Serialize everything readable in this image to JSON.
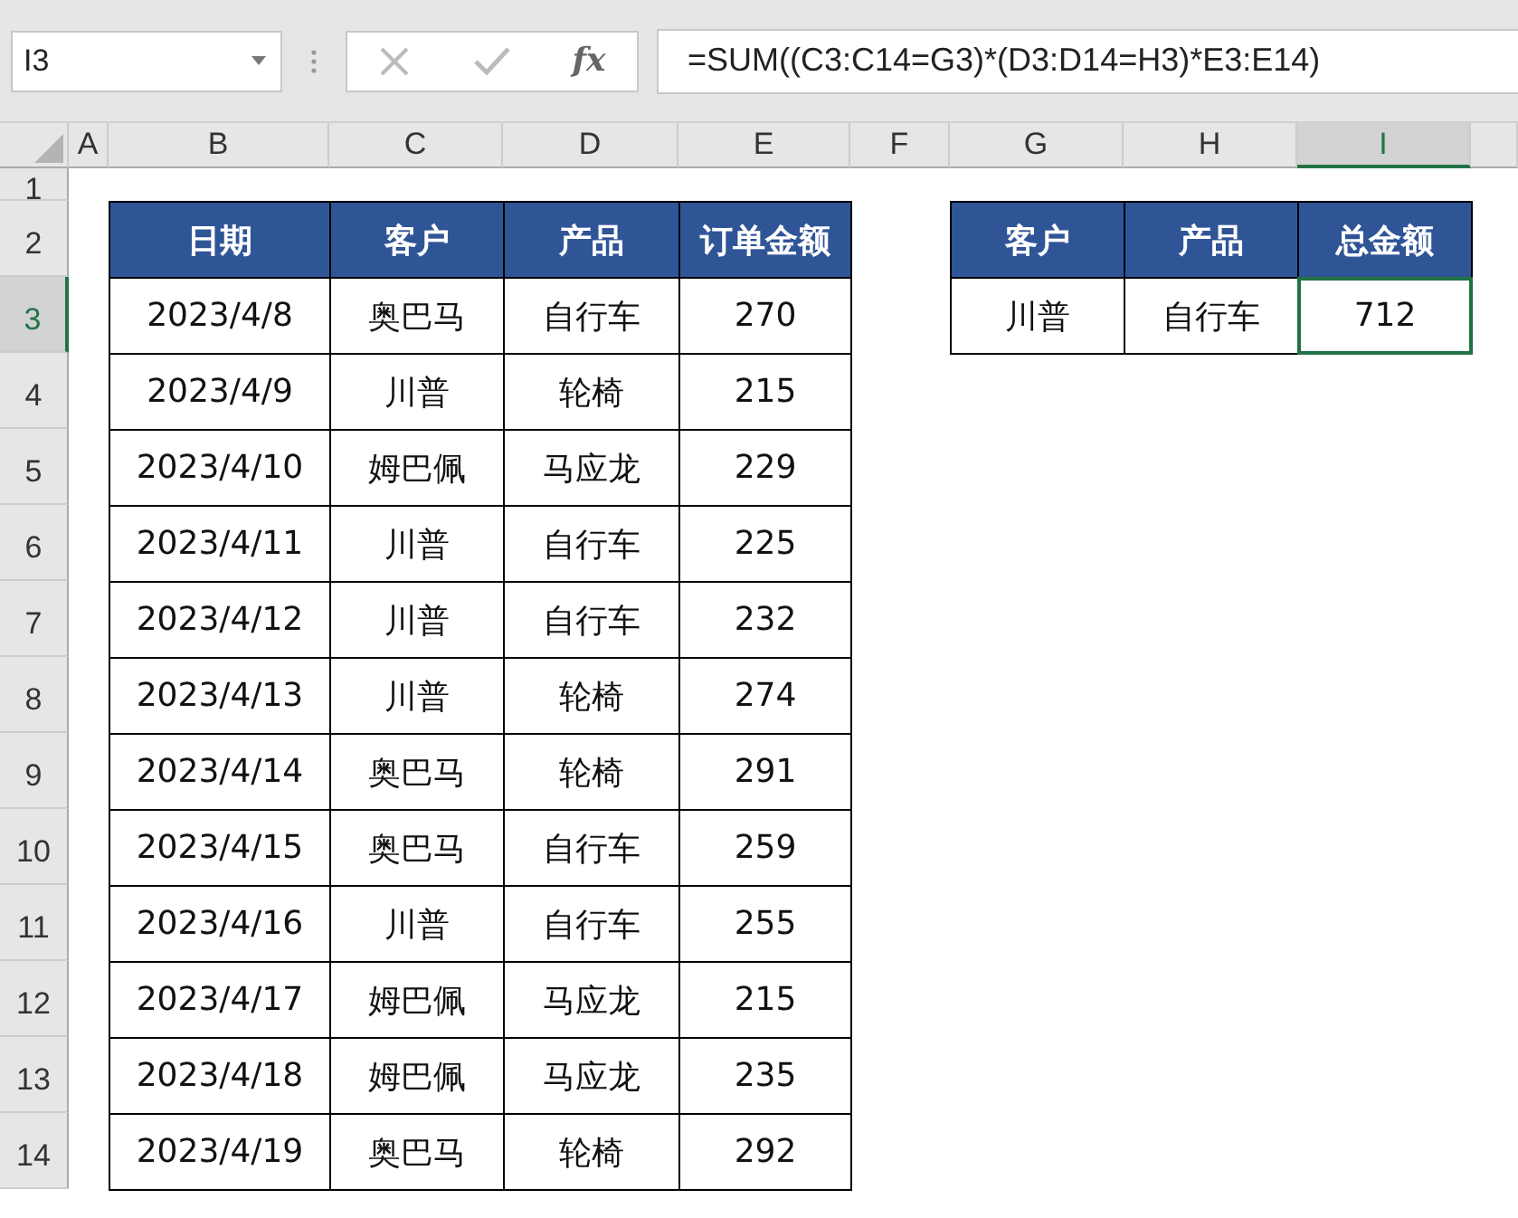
{
  "formula_bar": {
    "name_box": "I3",
    "function_label": "fx",
    "formula": "=SUM((C3:C14=G3)*(D3:D14=H3)*E3:E14)"
  },
  "sheet": {
    "columns": [
      {
        "label": "A",
        "selected": false
      },
      {
        "label": "B",
        "selected": false
      },
      {
        "label": "C",
        "selected": false
      },
      {
        "label": "D",
        "selected": false
      },
      {
        "label": "E",
        "selected": false
      },
      {
        "label": "F",
        "selected": false
      },
      {
        "label": "G",
        "selected": false
      },
      {
        "label": "H",
        "selected": false
      },
      {
        "label": "I",
        "selected": true
      }
    ],
    "rows": [
      {
        "label": "1",
        "selected": false
      },
      {
        "label": "2",
        "selected": false
      },
      {
        "label": "3",
        "selected": true
      },
      {
        "label": "4",
        "selected": false
      },
      {
        "label": "5",
        "selected": false
      },
      {
        "label": "6",
        "selected": false
      },
      {
        "label": "7",
        "selected": false
      },
      {
        "label": "8",
        "selected": false
      },
      {
        "label": "9",
        "selected": false
      },
      {
        "label": "10",
        "selected": false
      },
      {
        "label": "11",
        "selected": false
      },
      {
        "label": "12",
        "selected": false
      },
      {
        "label": "13",
        "selected": false
      },
      {
        "label": "14",
        "selected": false
      }
    ],
    "orders_table": {
      "headers": [
        "日期",
        "客户",
        "产品",
        "订单金额"
      ],
      "rows": [
        [
          "2023/4/8",
          "奥巴马",
          "自行车",
          "270"
        ],
        [
          "2023/4/9",
          "川普",
          "轮椅",
          "215"
        ],
        [
          "2023/4/10",
          "姆巴佩",
          "马应龙",
          "229"
        ],
        [
          "2023/4/11",
          "川普",
          "自行车",
          "225"
        ],
        [
          "2023/4/12",
          "川普",
          "自行车",
          "232"
        ],
        [
          "2023/4/13",
          "川普",
          "轮椅",
          "274"
        ],
        [
          "2023/4/14",
          "奥巴马",
          "轮椅",
          "291"
        ],
        [
          "2023/4/15",
          "奥巴马",
          "自行车",
          "259"
        ],
        [
          "2023/4/16",
          "川普",
          "自行车",
          "255"
        ],
        [
          "2023/4/17",
          "姆巴佩",
          "马应龙",
          "215"
        ],
        [
          "2023/4/18",
          "姆巴佩",
          "马应龙",
          "235"
        ],
        [
          "2023/4/19",
          "奥巴马",
          "轮椅",
          "292"
        ]
      ]
    },
    "summary_table": {
      "headers": [
        "客户",
        "产品",
        "总金额"
      ],
      "rows": [
        [
          {
            "text": "川普",
            "selected": false
          },
          {
            "text": "自行车",
            "selected": false
          },
          {
            "text": "712",
            "selected": true
          }
        ]
      ]
    }
  }
}
